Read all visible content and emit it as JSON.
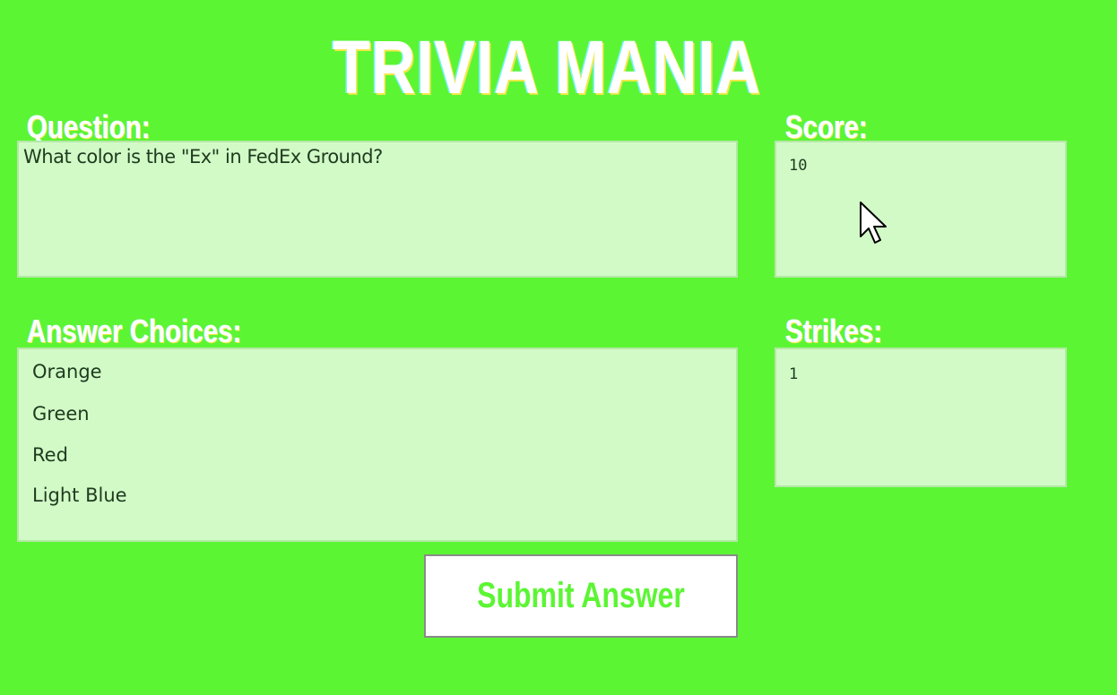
{
  "app": {
    "title": "TRIVIA MANIA"
  },
  "question": {
    "label": "Question:",
    "text": "What color is the \"Ex\" in FedEx Ground?"
  },
  "score": {
    "label": "Score:",
    "value": "10"
  },
  "answers": {
    "label": "Answer Choices:",
    "choices": [
      "Orange",
      "Green",
      "Red",
      "Light Blue"
    ]
  },
  "strikes": {
    "label": "Strikes:",
    "value": "1"
  },
  "submit": {
    "label": "Submit Answer"
  },
  "colors": {
    "background": "#5cf534",
    "panel": "#d2fac7",
    "title_text": "#ffffff",
    "button_text": "#5cf534"
  },
  "icons": {
    "cursor": "mouse-pointer-icon"
  }
}
